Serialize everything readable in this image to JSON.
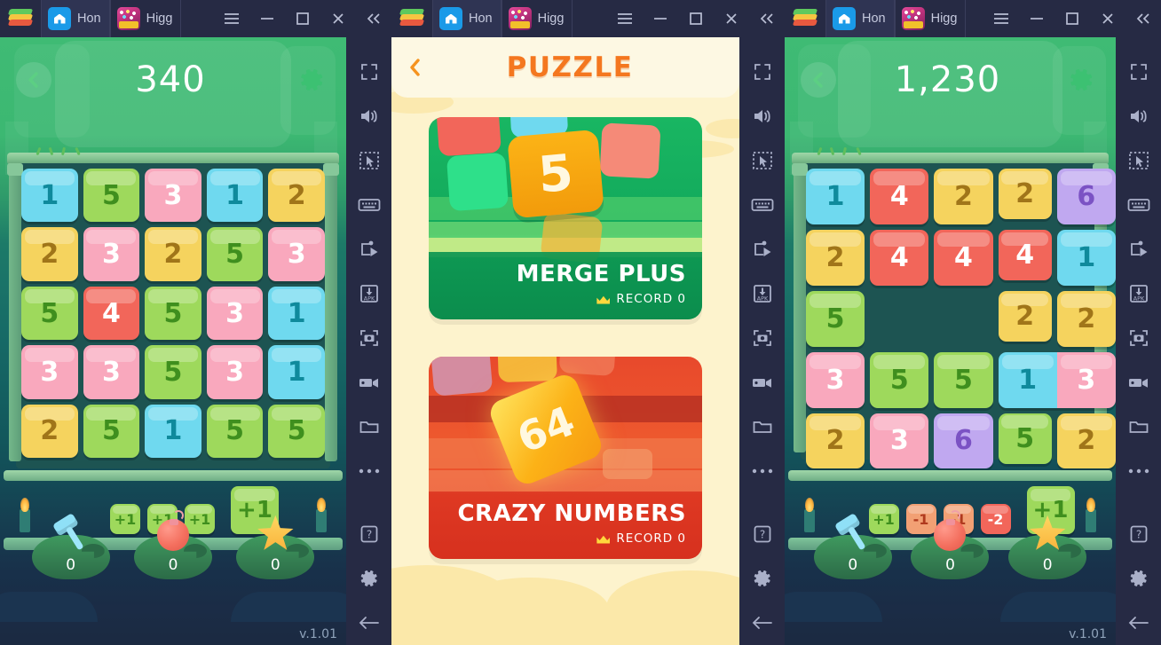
{
  "window": {
    "tabs": [
      {
        "label": "Hon",
        "icon": "home-icon",
        "active": true
      },
      {
        "label": "Higg",
        "icon": "higgs-domino-icon",
        "active": false
      }
    ],
    "controls": [
      {
        "name": "menu-button",
        "icon": "hamburger-icon"
      },
      {
        "name": "minimize-button",
        "icon": "minimize-icon"
      },
      {
        "name": "maximize-button",
        "icon": "maximize-icon"
      },
      {
        "name": "close-button",
        "icon": "close-icon"
      },
      {
        "name": "collapse-button",
        "icon": "double-chevron-left-icon"
      }
    ]
  },
  "sidebar": {
    "items": [
      {
        "name": "fullscreen-button",
        "icon": "fullscreen-icon"
      },
      {
        "name": "volume-button",
        "icon": "speaker-icon"
      },
      {
        "name": "pointer-button",
        "icon": "cursor-select-icon"
      },
      {
        "name": "keyboard-button",
        "icon": "keyboard-icon"
      },
      {
        "name": "game-controls-button",
        "icon": "game-controls-icon"
      },
      {
        "name": "install-apk-button",
        "icon": "apk-install-icon"
      },
      {
        "name": "screenshot-button",
        "icon": "camera-icon"
      },
      {
        "name": "record-button",
        "icon": "video-camera-icon"
      },
      {
        "name": "media-manager-button",
        "icon": "folder-icon"
      },
      {
        "name": "more-button",
        "icon": "ellipsis-icon"
      },
      {
        "name": "help-button",
        "icon": "question-mark-icon"
      },
      {
        "name": "settings-button",
        "icon": "gear-icon"
      },
      {
        "name": "back-button",
        "icon": "arrow-left-icon"
      }
    ]
  },
  "colors": {
    "cyan": "#6fd9ef",
    "cyan_text": "#0f8a9c",
    "green": "#9ed95c",
    "green_text": "#3f8f1e",
    "pink": "#f9a8bd",
    "pink_text": "#ffffff",
    "yellow": "#f5d35e",
    "yellow_text": "#a07519",
    "red": "#f2665a",
    "red_text": "#ffffff",
    "purple": "#c0a8f0",
    "purple_text": "#7b52c4",
    "brand_orange": "#f4771f",
    "merge_card_green": "#14a95c",
    "crazy_card_red": "#e8492c"
  },
  "left_game": {
    "score": "340",
    "version": "v.1.01",
    "back_icon": "chevron-left-icon",
    "settings_icon": "gear-icon",
    "grid": [
      [
        {
          "v": "1",
          "c": "cyan"
        },
        {
          "v": "5",
          "c": "green"
        },
        {
          "v": "3",
          "c": "pink"
        },
        {
          "v": "1",
          "c": "cyan"
        },
        {
          "v": "2",
          "c": "yellow"
        }
      ],
      [
        {
          "v": "2",
          "c": "yellow"
        },
        {
          "v": "3",
          "c": "pink"
        },
        {
          "v": "2",
          "c": "yellow"
        },
        {
          "v": "5",
          "c": "green"
        },
        {
          "v": "3",
          "c": "pink"
        }
      ],
      [
        {
          "v": "5",
          "c": "green"
        },
        {
          "v": "4",
          "c": "red"
        },
        {
          "v": "5",
          "c": "green"
        },
        {
          "v": "3",
          "c": "pink"
        },
        {
          "v": "1",
          "c": "cyan"
        }
      ],
      [
        {
          "v": "3",
          "c": "pink"
        },
        {
          "v": "3",
          "c": "pink"
        },
        {
          "v": "5",
          "c": "green"
        },
        {
          "v": "3",
          "c": "pink"
        },
        {
          "v": "1",
          "c": "cyan"
        }
      ],
      [
        {
          "v": "2",
          "c": "yellow"
        },
        {
          "v": "5",
          "c": "green"
        },
        {
          "v": "1",
          "c": "cyan"
        },
        {
          "v": "5",
          "c": "green"
        },
        {
          "v": "5",
          "c": "green"
        }
      ]
    ],
    "queue": [
      {
        "v": "+1",
        "c": "green",
        "size": "small"
      },
      {
        "v": "+1",
        "c": "green",
        "size": "small"
      },
      {
        "v": "+1",
        "c": "green",
        "size": "small"
      },
      {
        "v": "+1",
        "c": "green",
        "size": "big"
      }
    ],
    "powerups": [
      {
        "name": "hammer-powerup",
        "icon": "hammer-icon",
        "count": "0"
      },
      {
        "name": "bomb-powerup",
        "icon": "bomb-icon",
        "count": "0"
      },
      {
        "name": "star-powerup",
        "icon": "star-icon",
        "count": "0"
      }
    ]
  },
  "right_game": {
    "score": "1,230",
    "version": "v.1.01",
    "back_icon": "chevron-left-icon",
    "settings_icon": "gear-icon",
    "grid": [
      [
        {
          "v": "1",
          "c": "cyan"
        },
        {
          "v": "4",
          "c": "red"
        },
        {
          "v": "2",
          "c": "yellow"
        },
        {
          "v": "2",
          "c": "yellow"
        },
        {
          "v": "6",
          "c": "purple"
        }
      ],
      [
        {
          "v": "2",
          "c": "yellow"
        },
        {
          "v": "4",
          "c": "red"
        },
        {
          "v": "4",
          "c": "red"
        },
        {
          "v": "4",
          "c": "red"
        },
        {
          "v": "1",
          "c": "cyan"
        }
      ],
      [
        {
          "v": "5",
          "c": "green"
        },
        {
          "v": "",
          "c": "empty"
        },
        {
          "v": "",
          "c": "empty"
        },
        {
          "v": "2",
          "c": "yellow"
        },
        {
          "v": "2",
          "c": "yellow"
        }
      ],
      [
        {
          "v": "3",
          "c": "pink"
        },
        {
          "v": "5",
          "c": "green"
        },
        {
          "v": "5",
          "c": "green"
        },
        {
          "v": "1",
          "c": "cyan"
        },
        {
          "v": "3",
          "c": "pink"
        }
      ],
      [
        {
          "v": "2",
          "c": "yellow"
        },
        {
          "v": "3",
          "c": "pink"
        },
        {
          "v": "6",
          "c": "purple"
        },
        {
          "v": "5",
          "c": "green"
        },
        {
          "v": "2",
          "c": "yellow"
        }
      ]
    ],
    "queue": [
      {
        "v": "+1",
        "c": "green",
        "size": "small"
      },
      {
        "v": "-1",
        "c": "orange",
        "size": "small"
      },
      {
        "v": "-1",
        "c": "orange",
        "size": "small"
      },
      {
        "v": "-2",
        "c": "red",
        "size": "small"
      },
      {
        "v": "+1",
        "c": "green",
        "size": "big"
      }
    ],
    "powerups": [
      {
        "name": "hammer-powerup",
        "icon": "hammer-icon",
        "count": "0"
      },
      {
        "name": "bomb-powerup",
        "icon": "bomb-icon",
        "count": "0"
      },
      {
        "name": "star-powerup",
        "icon": "star-icon",
        "count": "0"
      }
    ]
  },
  "puzzle_menu": {
    "title": "PUZZLE",
    "back_icon": "chevron-left-icon",
    "cards": [
      {
        "name": "MERGE PLUS",
        "record_label": "RECORD 0",
        "tile_number": "5",
        "theme": "merge",
        "crown_icon": "crown-icon"
      },
      {
        "name": "CRAZY NUMBERS",
        "record_label": "RECORD 0",
        "tile_number": "64",
        "theme": "crazy",
        "crown_icon": "crown-icon"
      }
    ]
  }
}
